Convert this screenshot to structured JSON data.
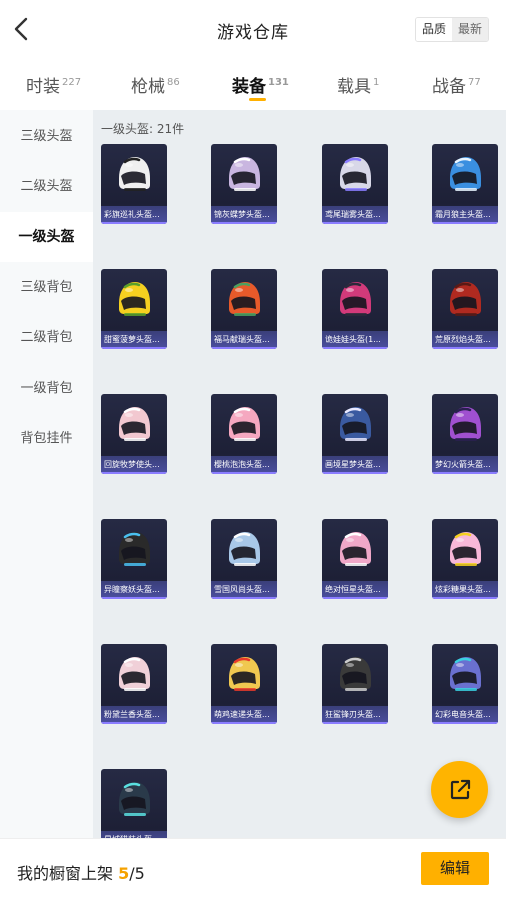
{
  "header": {
    "title": "游戏仓库",
    "sort_quality": "品质",
    "sort_newest": "最新"
  },
  "tabs": [
    {
      "label": "时装",
      "count": "227"
    },
    {
      "label": "枪械",
      "count": "86"
    },
    {
      "label": "装备",
      "count": "131"
    },
    {
      "label": "载具",
      "count": "1"
    },
    {
      "label": "战备",
      "count": "77"
    }
  ],
  "sidebar": {
    "items": [
      {
        "label": "三级头盔"
      },
      {
        "label": "二级头盔"
      },
      {
        "label": "一级头盔"
      },
      {
        "label": "三级背包"
      },
      {
        "label": "二级背包"
      },
      {
        "label": "一级背包"
      },
      {
        "label": "背包挂件"
      }
    ]
  },
  "content": {
    "count_label": "一级头盔: 21件",
    "items": [
      {
        "name": "彩旗巡礼头盔...",
        "color": "#f0f0f0",
        "accent": "#222222"
      },
      {
        "name": "锦灰蝶梦头盔...",
        "color": "#c9b6e0",
        "accent": "#ffffff"
      },
      {
        "name": "鸢尾瑞雾头盔...",
        "color": "#d8d8e8",
        "accent": "#8a7cff"
      },
      {
        "name": "霜月狼主头盔...",
        "color": "#3a8fe0",
        "accent": "#e8f4ff"
      },
      {
        "name": "甜蜜菠萝头盔...",
        "color": "#f5d020",
        "accent": "#5aa02a"
      },
      {
        "name": "福马献瑞头盔...",
        "color": "#e85a2a",
        "accent": "#4aa060"
      },
      {
        "name": "诡娃娃头盔(1...",
        "color": "#d23a7a",
        "accent": "#2a2a3a"
      },
      {
        "name": "荒原烈焰头盔...",
        "color": "#b02a20",
        "accent": "#5a1a15"
      },
      {
        "name": "回旋牧梦使头...",
        "color": "#f2c8d0",
        "accent": "#ffffff"
      },
      {
        "name": "樱桃泡泡头盔...",
        "color": "#f5a8c0",
        "accent": "#ffffff"
      },
      {
        "name": "画境星梦头盔...",
        "color": "#3a5aa0",
        "accent": "#e8e8ff"
      },
      {
        "name": "梦幻火箭头盔...",
        "color": "#a050d0",
        "accent": "#2a2050"
      },
      {
        "name": "异瞳察妖头盔...",
        "color": "#2a2a2a",
        "accent": "#4ac0f0"
      },
      {
        "name": "雪国风尚头盔...",
        "color": "#a8c8e8",
        "accent": "#ffffff"
      },
      {
        "name": "绝对恒星头盔...",
        "color": "#f0a8c8",
        "accent": "#ffffff"
      },
      {
        "name": "炫彩糖果头盔...",
        "color": "#f8b8d8",
        "accent": "#f5d020"
      },
      {
        "name": "粉黛兰香头盔...",
        "color": "#f0d0d8",
        "accent": "#ffffff"
      },
      {
        "name": "萌鸡速递头盔...",
        "color": "#f0c850",
        "accent": "#e83a2a"
      },
      {
        "name": "狂鲨锋刃头盔...",
        "color": "#3a3a3a",
        "accent": "#cccccc"
      },
      {
        "name": "幻彩电音头盔...",
        "color": "#6a70d0",
        "accent": "#3ad0e0"
      },
      {
        "name": "星城猎装头盔...",
        "color": "#2a3a4a",
        "accent": "#5ae0e0"
      }
    ]
  },
  "footer": {
    "label": "我的橱窗上架",
    "shelved": "5",
    "separator": "/",
    "capacity": "5",
    "edit_label": "编辑"
  },
  "colors": {
    "accent": "#ffb000",
    "sidebar_bg": "#f7f9fa",
    "content_bg": "#eaeef1",
    "card_bg": "#1d2036"
  },
  "icons": {
    "back": "chevron-left-icon",
    "fab": "share-external-icon"
  }
}
